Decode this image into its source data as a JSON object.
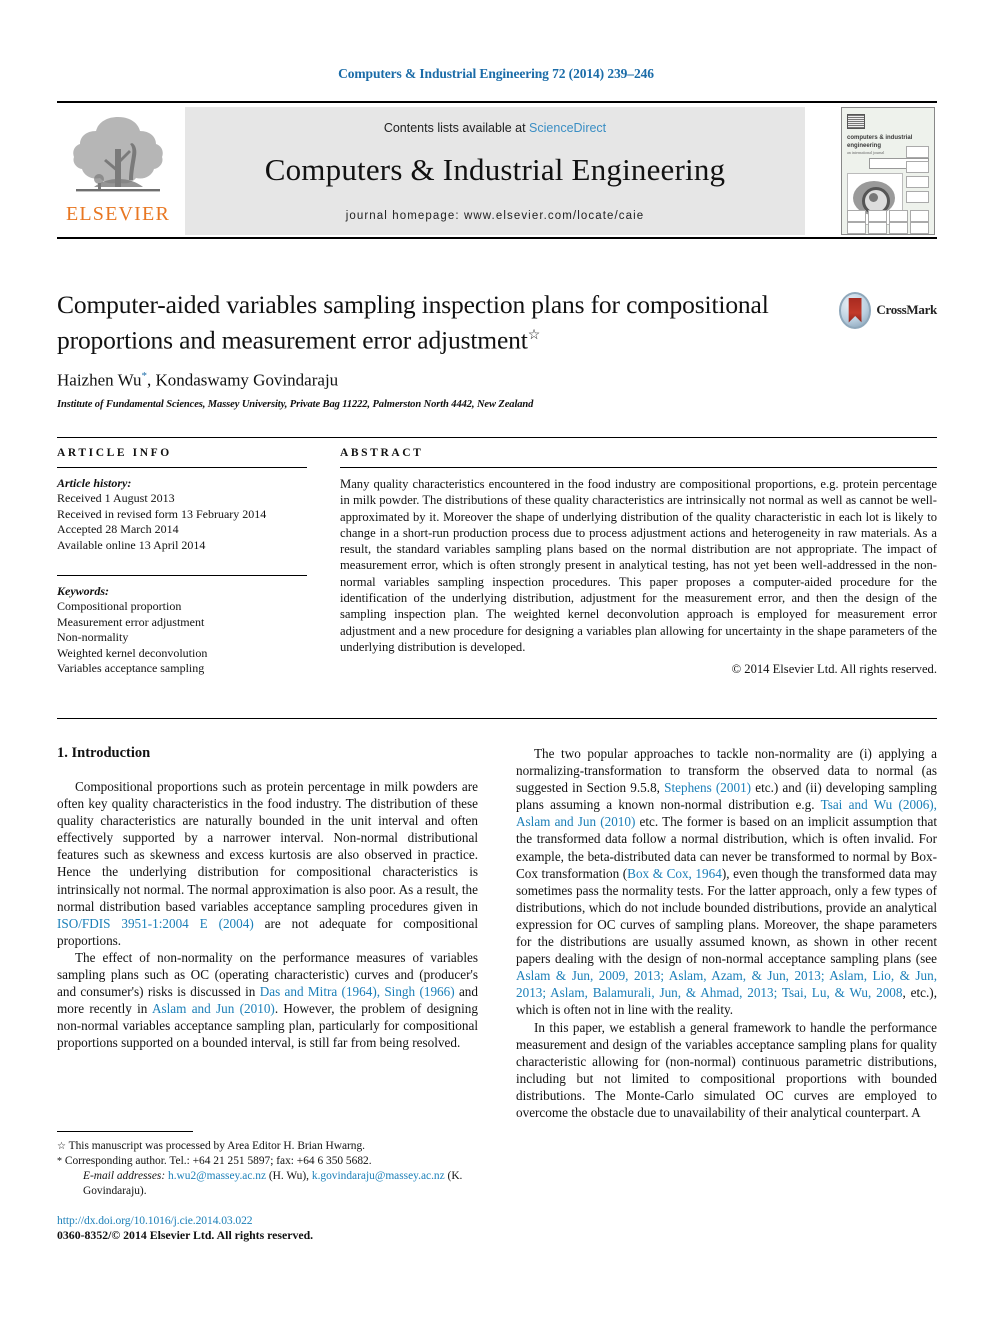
{
  "running_head": "Computers & Industrial Engineering 72 (2014) 239–246",
  "masthead": {
    "contents_prefix": "Contents lists available at ",
    "sciencedirect": "ScienceDirect",
    "journal_title": "Computers & Industrial Engineering",
    "homepage": "journal homepage: www.elsevier.com/locate/caie",
    "publisher_name": "ELSEVIER",
    "cover_title": "computers & industrial engineering",
    "cover_subtitle": "an international journal",
    "accent_link": "#3a8ec4",
    "accent_publisher": "#e87722"
  },
  "article": {
    "title": "Computer-aided variables sampling inspection plans for compositional proportions and measurement error adjustment",
    "title_marker": "☆",
    "authors": "Haizhen Wu",
    "authors_marker": "*",
    "authors_rest": ", Kondaswamy Govindaraju",
    "affiliation": "Institute of Fundamental Sciences, Massey University, Private Bag 11222, Palmerston North 4442, New Zealand",
    "crossmark_label": "CrossMark"
  },
  "info": {
    "heading": "ARTICLE INFO",
    "history_heading": "Article history:",
    "history": [
      "Received 1 August 2013",
      "Received in revised form 13 February 2014",
      "Accepted 28 March 2014",
      "Available online 13 April 2014"
    ],
    "keywords_heading": "Keywords:",
    "keywords": [
      "Compositional proportion",
      "Measurement error adjustment",
      "Non-normality",
      "Weighted kernel deconvolution",
      "Variables acceptance sampling"
    ]
  },
  "abstract": {
    "heading": "ABSTRACT",
    "text": "Many quality characteristics encountered in the food industry are compositional proportions, e.g. protein percentage in milk powder. The distributions of these quality characteristics are intrinsically not normal as well as cannot be well-approximated by it. Moreover the shape of underlying distribution of the quality characteristic in each lot is likely to change in a short-run production process due to process adjustment actions and heterogeneity in raw materials. As a result, the standard variables sampling plans based on the normal distribution are not appropriate. The impact of measurement error, which is often strongly present in analytical testing, has not yet been well-addressed in the non-normal variables sampling inspection procedures. This paper proposes a computer-aided procedure for the identification of the underlying distribution, adjustment for the measurement error, and then the design of the sampling inspection plan. The weighted kernel deconvolution approach is employed for measurement error adjustment and a new procedure for designing a variables plan allowing for uncertainty in the shape parameters of the underlying distribution is developed.",
    "copyright": "© 2014 Elsevier Ltd. All rights reserved."
  },
  "body": {
    "section_number_title": "1. Introduction",
    "left_paragraphs": [
      {
        "segments": [
          {
            "t": "Compositional proportions such as protein percentage in milk powders are often key quality characteristics in the food industry. The distribution of these quality characteristics are naturally bounded in the unit interval and often effectively supported by a narrower interval. Non-normal distributional features such as skewness and excess kurtosis are also observed in practice. Hence the underlying distribution for compositional characteristics is intrinsically not normal. The normal approximation is also poor. As a result, the normal distribution based variables acceptance sampling procedures given in ",
            "link": false
          },
          {
            "t": "ISO/FDIS 3951-1:2004 E (2004)",
            "link": true
          },
          {
            "t": " are not adequate for compositional proportions.",
            "link": false
          }
        ]
      },
      {
        "segments": [
          {
            "t": "The effect of non-normality on the performance measures of variables sampling plans such as OC (operating characteristic) curves and (producer's and consumer's) risks is discussed in ",
            "link": false
          },
          {
            "t": "Das and Mitra (1964), Singh (1966)",
            "link": true
          },
          {
            "t": " and more recently in ",
            "link": false
          },
          {
            "t": "Aslam and Jun (2010)",
            "link": true
          },
          {
            "t": ". However, the problem of designing non-normal variables acceptance sampling plan, particularly for compositional proportions supported on a bounded interval, is still far from being resolved.",
            "link": false
          }
        ]
      }
    ],
    "right_paragraphs": [
      {
        "segments": [
          {
            "t": "The two popular approaches to tackle non-normality are (i) applying a normalizing-transformation to transform the observed data to normal (as suggested in Section 9.5.8, ",
            "link": false
          },
          {
            "t": "Stephens (2001)",
            "link": true
          },
          {
            "t": " etc.) and (ii) developing sampling plans assuming a known non-normal distribution e.g. ",
            "link": false
          },
          {
            "t": "Tsai and Wu (2006), Aslam and Jun (2010)",
            "link": true
          },
          {
            "t": " etc. The former is based on an implicit assumption that the transformed data follow a normal distribution, which is often invalid. For example, the beta-distributed data can never be transformed to normal by Box-Cox transformation (",
            "link": false
          },
          {
            "t": "Box & Cox, 1964",
            "link": true
          },
          {
            "t": "), even though the transformed data may sometimes pass the normality tests. For the latter approach, only a few types of distributions, which do not include bounded distributions, provide an analytical expression for OC curves of sampling plans. Moreover, the shape parameters for the distributions are usually assumed known, as shown in other recent papers dealing with the design of non-normal acceptance sampling plans (see ",
            "link": false
          },
          {
            "t": "Aslam & Jun, 2009, 2013; Aslam, Azam, & Jun, 2013; Aslam, Lio, & Jun, 2013; Aslam, Balamurali, Jun, & Ahmad, 2013; Tsai, Lu, & Wu, 2008",
            "link": true
          },
          {
            "t": ", etc.), which is often not in line with the reality.",
            "link": false
          }
        ]
      },
      {
        "segments": [
          {
            "t": "In this paper, we establish a general framework to handle the performance measurement and design of the variables acceptance sampling plans for quality characteristic allowing for (non-normal) continuous parametric distributions, including but not limited to compositional proportions with bounded distributions. The Monte-Carlo simulated OC curves are employed to overcome the obstacle due to unavailability of their analytical counterpart. A",
            "link": false
          }
        ]
      }
    ]
  },
  "footnotes": {
    "line1_symbol": "☆",
    "line1": "This manuscript was processed by Area Editor H. Brian Hwarng.",
    "line2_symbol": "*",
    "line2": "Corresponding author. Tel.: +64 21 251 5897; fax: +64 6 350 5682.",
    "email_label": "E-mail addresses:",
    "email1": "h.wu2@massey.ac.nz",
    "email1_owner": "(H. Wu),",
    "email2": "k.govindaraju@massey.ac.nz",
    "email2_owner": "(K. Govindaraju)."
  },
  "footer": {
    "doi": "http://dx.doi.org/10.1016/j.cie.2014.03.022",
    "issn_copyright": "0360-8352/© 2014 Elsevier Ltd. All rights reserved."
  }
}
